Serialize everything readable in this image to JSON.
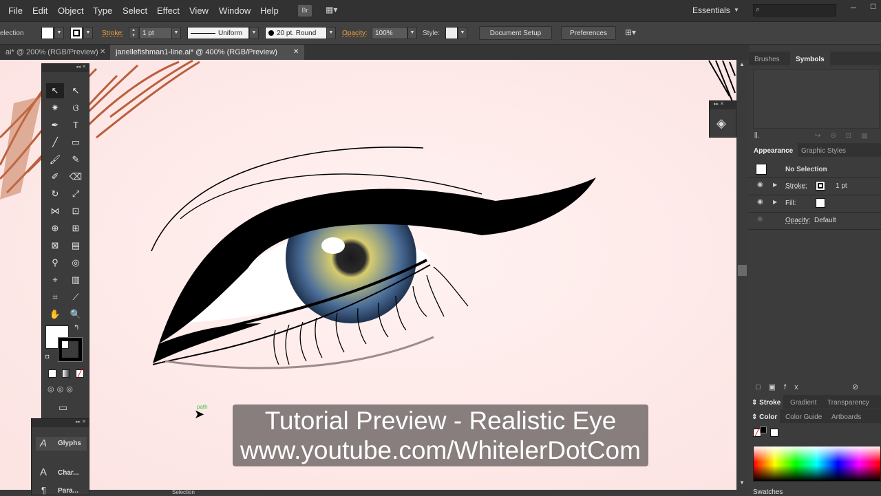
{
  "menubar": {
    "items": [
      "File",
      "Edit",
      "Object",
      "Type",
      "Select",
      "Effect",
      "View",
      "Window",
      "Help"
    ],
    "bridge_label": "Br",
    "workspace": "Essentials",
    "search_placeholder": ""
  },
  "control_bar": {
    "selection_label": "election",
    "stroke_label": "Stroke:",
    "stroke_weight": "1 pt",
    "profile_label": "Uniform",
    "brush_label": "20 pt. Round",
    "opacity_label": "Opacity:",
    "opacity_value": "100%",
    "style_label": "Style:",
    "document_setup": "Document Setup",
    "preferences": "Preferences"
  },
  "tabs": [
    {
      "label": "ai* @ 200% (RGB/Preview)",
      "close": "✕"
    },
    {
      "label": "janellefishman1-line.ai* @ 400% (RGB/Preview)",
      "close": "✕"
    }
  ],
  "right_panel": {
    "top_tabs": [
      "Brushes",
      "Symbols"
    ],
    "appearance_tabs": [
      "Appearance",
      "Graphic Styles"
    ],
    "no_selection": "No Selection",
    "stroke_label": "Stroke:",
    "stroke_value": "1 pt",
    "fill_label": "Fill:",
    "opacity_label": "Opacity:",
    "opacity_value": "Default",
    "stroke_group_tabs": [
      "Stroke",
      "Gradient",
      "Transparency"
    ],
    "color_group_tabs": [
      "Color",
      "Color Guide",
      "Artboards"
    ],
    "swatches": "Swatches"
  },
  "glyphs_panel": {
    "items": [
      "Glyphs",
      "Char...",
      "Para..."
    ]
  },
  "canvas": {
    "cursor_hint": "path"
  },
  "caption": {
    "line1": "Tutorial Preview - Realistic Eye",
    "line2": "www.youtube.com/WhitelerDotCom"
  },
  "statusbar": {
    "tool_name": "Selection"
  },
  "colors": {
    "canvas_bg": "#fde9e8",
    "ui_bg": "#3c3c3c",
    "accent_orange": "#f0a040",
    "iris_blue": "#3e5e8a",
    "iris_gold": "#c9c26a"
  }
}
